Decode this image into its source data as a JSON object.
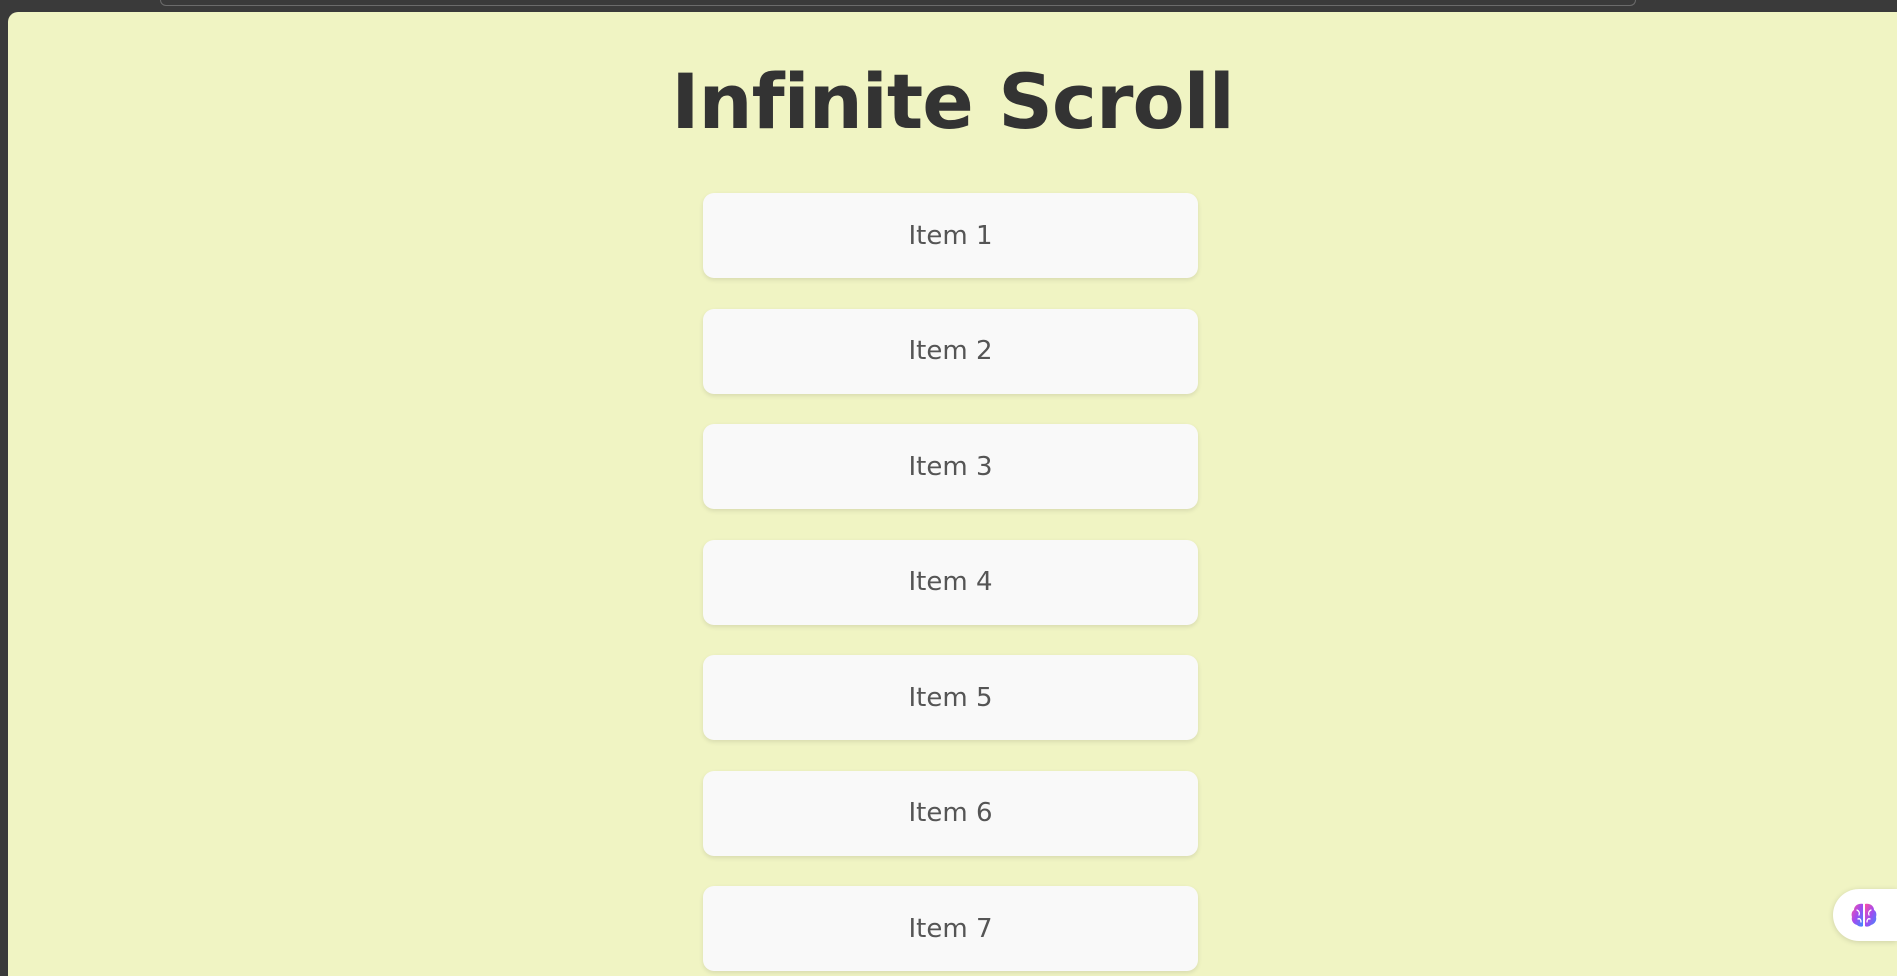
{
  "page": {
    "title": "Infinite Scroll"
  },
  "items": [
    {
      "label": "Item 1"
    },
    {
      "label": "Item 2"
    },
    {
      "label": "Item 3"
    },
    {
      "label": "Item 4"
    },
    {
      "label": "Item 5"
    },
    {
      "label": "Item 6"
    },
    {
      "label": "Item 7"
    }
  ],
  "widgets": {
    "assistant_icon": "brain-icon"
  },
  "colors": {
    "background": "#f0f4c3",
    "card": "#f9f9f9",
    "title_text": "#333333",
    "item_text": "#555555"
  }
}
